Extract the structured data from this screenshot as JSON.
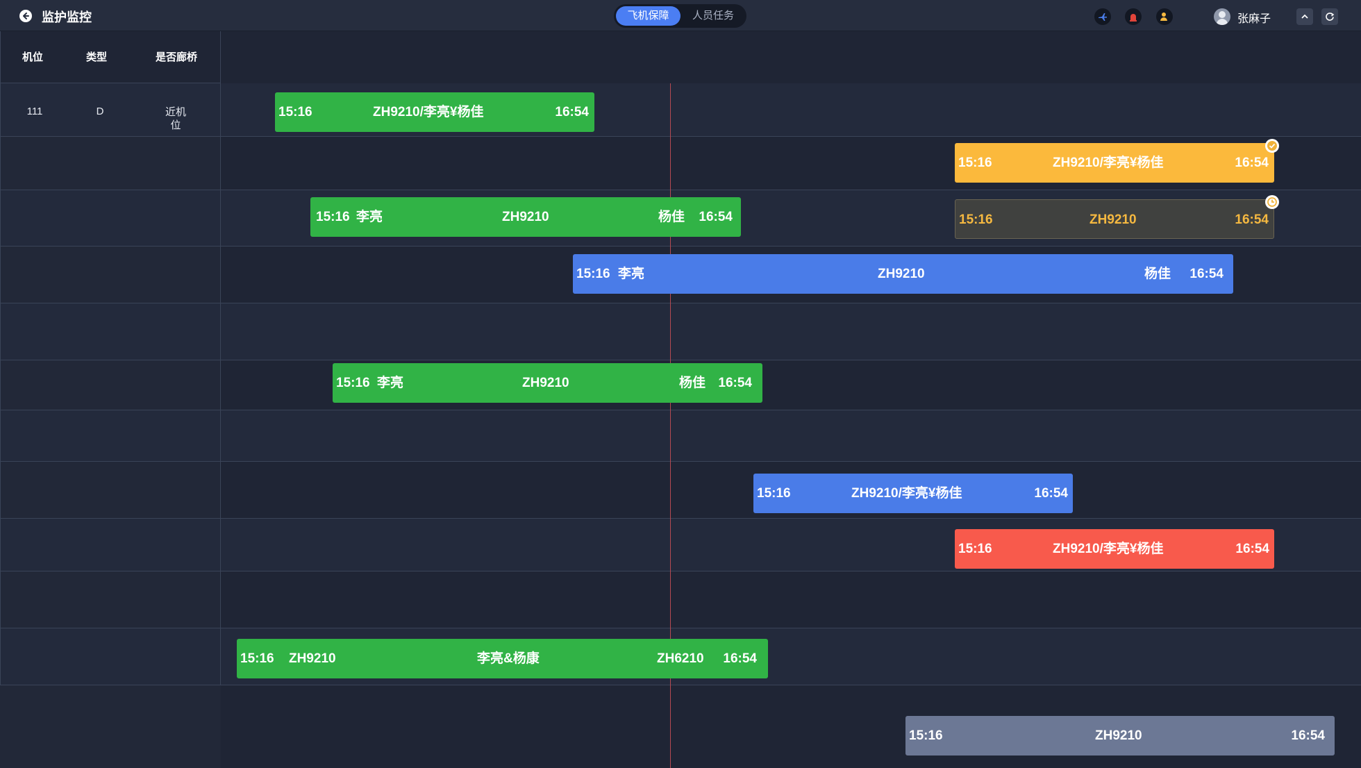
{
  "header": {
    "title": "监护监控",
    "tabs": [
      {
        "label": "飞机保障",
        "active": true
      },
      {
        "label": "人员任务",
        "active": false
      }
    ],
    "status_icons": [
      "plane-status-icon",
      "alarm-status-icon",
      "person-status-icon"
    ],
    "user_name": "张麻子"
  },
  "table": {
    "columns": [
      "机位",
      "类型",
      "是否廊桥"
    ],
    "rows": [
      {
        "stand": "111",
        "type": "D",
        "bridge": "近机位"
      }
    ]
  },
  "tasks": [
    {
      "color": "green",
      "start": "15:16",
      "end": "16:54",
      "center": "ZH9210/李亮¥杨佳"
    },
    {
      "color": "yellow",
      "start": "15:16",
      "end": "16:54",
      "center": "ZH9210/李亮¥杨佳",
      "badge": "check-icon"
    },
    {
      "color": "green",
      "start": "15:16",
      "end": "16:54",
      "left": "李亮",
      "center": "ZH9210",
      "right": "杨佳"
    },
    {
      "color": "dark",
      "start": "15:16",
      "end": "16:54",
      "center": "ZH9210",
      "badge": "clock-icon"
    },
    {
      "color": "blue",
      "start": "15:16",
      "end": "16:54",
      "left": "李亮",
      "center": "ZH9210",
      "right": "杨佳"
    },
    {
      "color": "green",
      "start": "15:16",
      "end": "16:54",
      "left": "李亮",
      "center": "ZH9210",
      "right": "杨佳"
    },
    {
      "color": "blue",
      "start": "15:16",
      "end": "16:54",
      "center": "ZH9210/李亮¥杨佳"
    },
    {
      "color": "red",
      "start": "15:16",
      "end": "16:54",
      "center": "ZH9210/李亮¥杨佳"
    },
    {
      "color": "green",
      "start": "15:16",
      "end": "16:54",
      "left": "ZH9210",
      "center": "李亮&杨康",
      "right": "ZH6210"
    },
    {
      "color": "gray",
      "start": "15:16",
      "end": "16:54",
      "center": "ZH9210"
    }
  ],
  "colors": {
    "green": "#31b346",
    "yellow": "#fbb93c",
    "blue": "#4a7ce8",
    "red": "#f85a4c",
    "gray": "#6c7895",
    "now_line": "#b64a52"
  }
}
